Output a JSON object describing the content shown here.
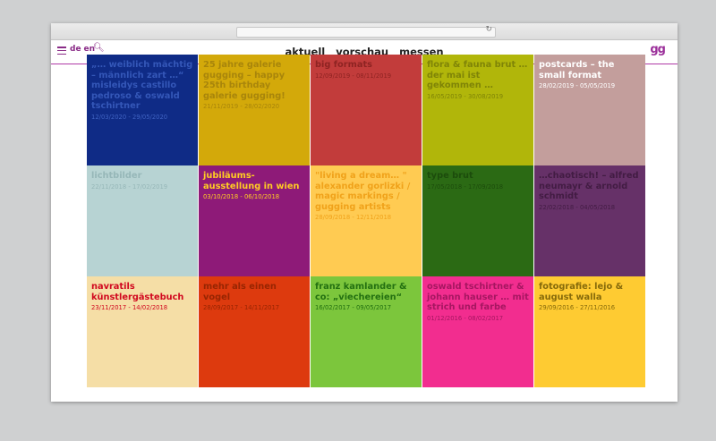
{
  "header": {
    "lang": [
      "de",
      "en"
    ],
    "nav": [
      "aktuell",
      "vorschau",
      "messen"
    ],
    "logo": "gg"
  },
  "tiles": [
    {
      "title": "„… weiblich mächtig – männlich zart …“ misleidys castillo pedroso & oswald tschirtner",
      "date": "12/03/2020 - 29/05/2020",
      "bg": "#0f2b86",
      "fg": "#3457b8",
      "dateColor": "#3f62c2"
    },
    {
      "title": "25 jahre galerie gugging – happy 25th birthday galerie gugging!",
      "date": "21/11/2019 - 28/02/2020",
      "bg": "#d3a90a",
      "fg": "#a8850b",
      "dateColor": "#a8850b"
    },
    {
      "title": "big formats",
      "date": "12/09/2019 - 08/11/2019",
      "bg": "#c23c3b",
      "fg": "#8e2322",
      "dateColor": "#8e2322"
    },
    {
      "title": "flora & fauna brut … der mai ist gekommen …",
      "date": "16/05/2019 - 30/08/2019",
      "bg": "#b1b60a",
      "fg": "#7f8407",
      "dateColor": "#7f8407"
    },
    {
      "title": "postcards – the small format",
      "date": "28/02/2019 - 05/05/2019",
      "bg": "#c39e9c",
      "fg": "#ffffff",
      "dateColor": "#ffffff"
    },
    {
      "title": "lichtbilder",
      "date": "22/11/2018 - 17/02/2019",
      "bg": "#b7d3d3",
      "fg": "#96b7b8",
      "dateColor": "#96b7b8"
    },
    {
      "title": "jubiläums-ausstellung in wien",
      "date": "03/10/2018 - 06/10/2018",
      "bg": "#8e1a78",
      "fg": "#ffcc23",
      "dateColor": "#ffcc23"
    },
    {
      "title": "\"living a dream… \" alexander gorlizki / magic markings / gugging artists",
      "date": "28/09/2018 - 12/11/2018",
      "bg": "#ffcb52",
      "fg": "#f0a21a",
      "dateColor": "#f0a21a"
    },
    {
      "title": "type brut",
      "date": "17/05/2018 - 17/09/2018",
      "bg": "#2b6a14",
      "fg": "#1c4c0c",
      "dateColor": "#1c4c0c"
    },
    {
      "title": "…chaotisch! – alfred neumayr & arnold schmidt",
      "date": "22/02/2018 - 04/05/2018",
      "bg": "#663168",
      "fg": "#421c43",
      "dateColor": "#421c43"
    },
    {
      "title": "navratils künstlergästebuch",
      "date": "23/11/2017 - 14/02/2018",
      "bg": "#f5dea6",
      "fg": "#d1081f",
      "dateColor": "#d1081f"
    },
    {
      "title": "mehr als einen vogel",
      "date": "28/09/2017 - 14/11/2017",
      "bg": "#dd3a0e",
      "fg": "#972502",
      "dateColor": "#972502"
    },
    {
      "title": "franz kamlander & co: „viechereien“",
      "date": "16/02/2017 - 09/05/2017",
      "bg": "#7cc63c",
      "fg": "#237011",
      "dateColor": "#237011"
    },
    {
      "title": "oswald tschirtner & johann hauser … mit strich und farbe",
      "date": "01/12/2016 - 08/02/2017",
      "bg": "#f22d8f",
      "fg": "#a61661",
      "dateColor": "#a61661"
    },
    {
      "title": "fotografie: lejo & august walla",
      "date": "29/09/2016 - 27/11/2016",
      "bg": "#fecb32",
      "fg": "#866a0a",
      "dateColor": "#866a0a"
    }
  ]
}
